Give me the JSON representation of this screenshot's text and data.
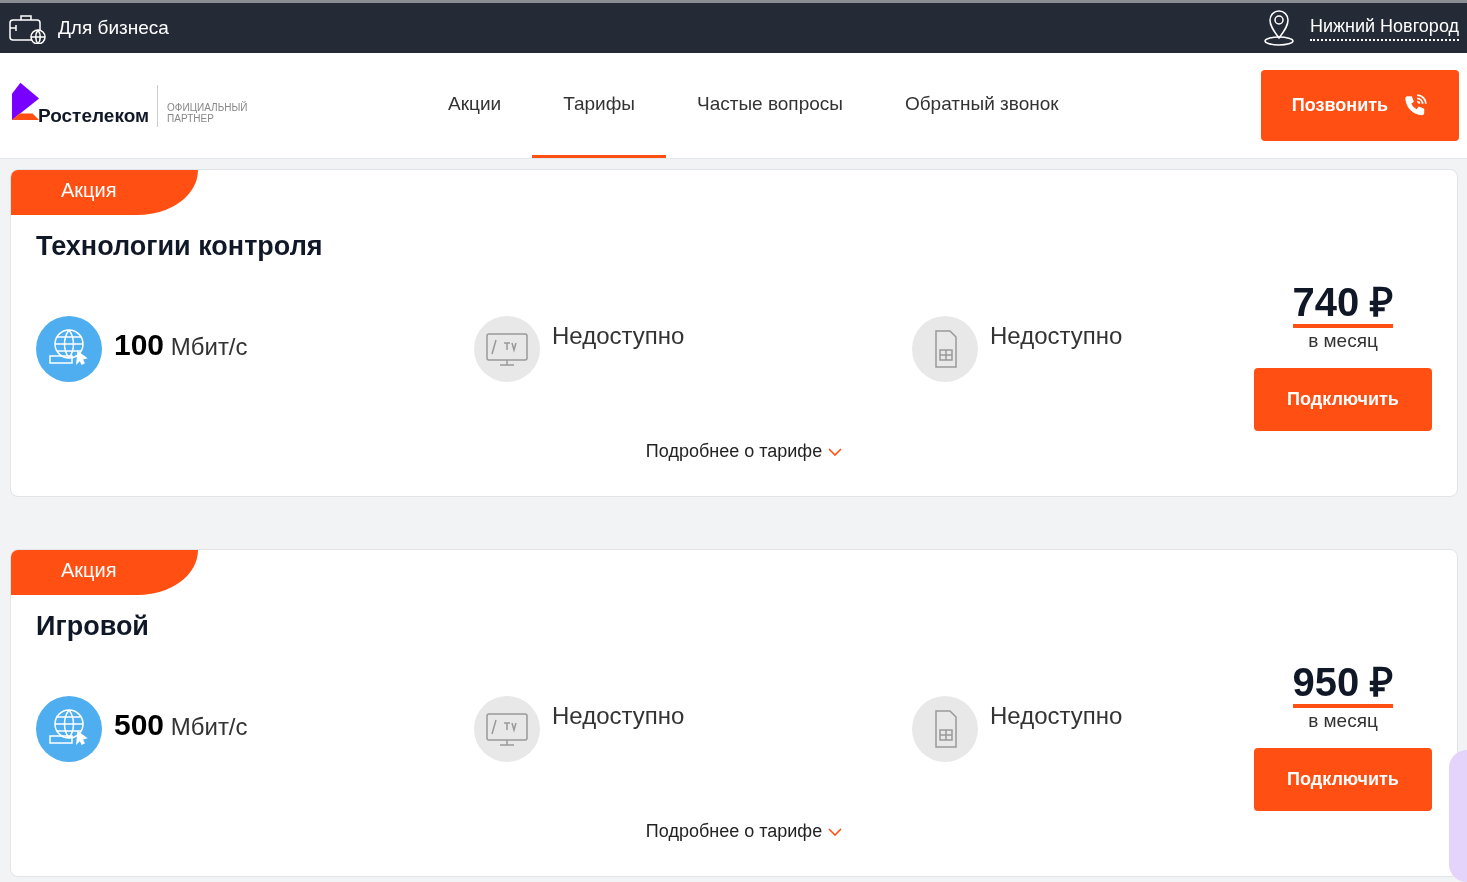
{
  "top_bar": {
    "business_label": "Для бизнеса",
    "city": "Нижний Новгород"
  },
  "header": {
    "logo_name": "Ростелеком",
    "partner_label": "ОФИЦИАЛЬНЫЙ ПАРТНЕР",
    "call_button": "Позвонить"
  },
  "nav": [
    {
      "label": "Акции",
      "selected": false
    },
    {
      "label": "Тарифы",
      "selected": true
    },
    {
      "label": "Частые вопросы",
      "selected": false
    },
    {
      "label": "Обратный звонок",
      "selected": false
    }
  ],
  "tariffs": [
    {
      "badge": "Акция",
      "title": "Технологии контроля",
      "features": [
        {
          "kind": "internet",
          "available": true,
          "value": "100",
          "unit": "Мбит/с"
        },
        {
          "kind": "tv",
          "available": false,
          "value": "Недоступно"
        },
        {
          "kind": "sim",
          "available": false,
          "value": "Недоступно"
        }
      ],
      "price": "740 ₽",
      "period": "в месяц",
      "button": "Подключить",
      "details": "Подробнее о тарифе"
    },
    {
      "badge": "Акция",
      "title": "Игровой",
      "features": [
        {
          "kind": "internet",
          "available": true,
          "value": "500",
          "unit": "Мбит/с"
        },
        {
          "kind": "tv",
          "available": false,
          "value": "Недоступно"
        },
        {
          "kind": "sim",
          "available": false,
          "value": "Недоступно"
        }
      ],
      "price": "950 ₽",
      "period": "в месяц",
      "button": "Подключить",
      "details": "Подробнее о тарифе"
    }
  ]
}
